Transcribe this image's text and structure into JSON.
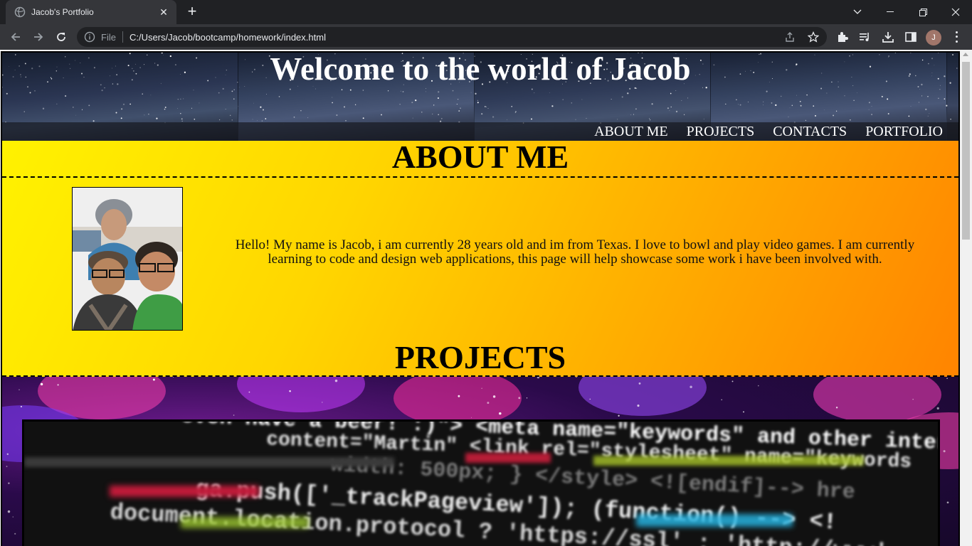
{
  "browser": {
    "tab_title": "Jacob's Portfolio",
    "address_scheme": "File",
    "address_url": "C:/Users/Jacob/bootcamp/homework/index.html",
    "profile_initial": "J",
    "icons": [
      "back-icon",
      "forward-icon",
      "reload-icon",
      "info-icon",
      "share-icon",
      "star-icon",
      "extensions-icon",
      "media-icon",
      "download-icon",
      "sidepanel-icon",
      "menu-icon"
    ]
  },
  "header": {
    "title": "Welcome to the world of Jacob",
    "nav": [
      "ABOUT ME",
      "PROJECTS",
      "CONTACTS",
      "PORTFOLIO"
    ]
  },
  "about": {
    "heading": "ABOUT ME",
    "text": "Hello! My name is Jacob, i am currently 28 years old and im from Texas. I love to bowl and play video games. I am currently learning to code and design web applications, this page will help showcase some work i have been involved with."
  },
  "projects": {
    "heading": "PROJECTS",
    "code_lines": [
      "even have a beer! :)\"> <meta name=\"keywords\" and other interes",
      "content=\"Martin\" <link rel=\"stylesheet\" name=\"keywords",
      "width: 500px; } </style> <![endif]--> hre",
      "ga.push(['_trackPageview']); (function() --> <!",
      "document.location.protocol ? 'https://ssl' : 'http://www'"
    ]
  },
  "colors": {
    "about_gradient_start": "#fff200",
    "about_gradient_end": "#ff8400",
    "chrome_dark": "#202124",
    "chrome_toolbar": "#35363a"
  }
}
